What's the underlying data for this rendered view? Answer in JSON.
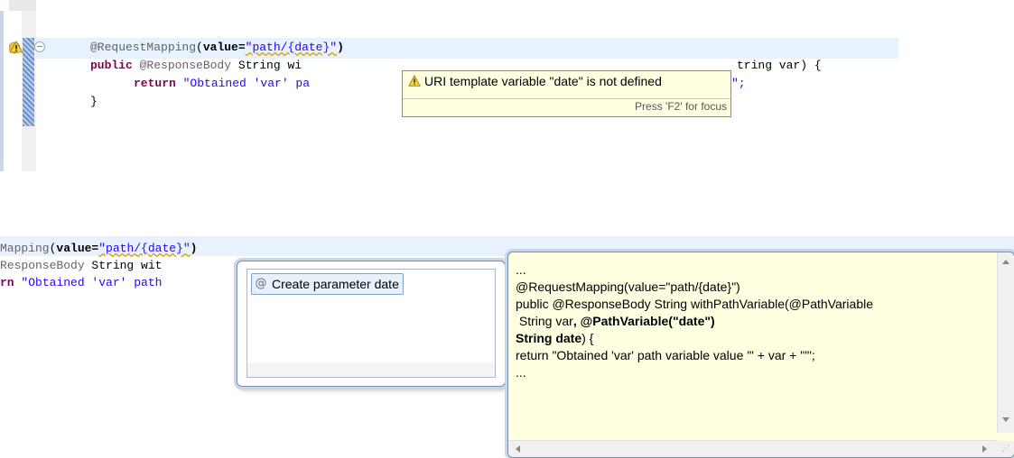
{
  "top_editor": {
    "lines": [
      {
        "ann": "@RequestMapping",
        "p1": "(",
        "p2": "value=",
        "str": "\"path/{date}\"",
        "p3": ")"
      },
      {
        "kw1": "public",
        "ann": " @ResponseBody",
        "p1": " String wi",
        "p2": "tring var) {"
      },
      {
        "kw1": "return",
        "str": " \"Obtained 'var' pa",
        "p2": "\";"
      },
      {
        "p1": "}"
      }
    ],
    "hover": {
      "message": "URI template variable \"date\" is not defined",
      "focus_hint": "Press 'F2' for focus",
      "icon": "warning-icon"
    }
  },
  "bottom_editor": {
    "lines": [
      {
        "ann": "Mapping",
        "p1": "(",
        "p2": "value=",
        "str": "\"path/{date}\"",
        "p3": ")"
      },
      {
        "ann": "ResponseBody",
        "p1": " String wit"
      },
      {
        "kw1": "rn",
        "str": " \"Obtained 'var' path"
      }
    ]
  },
  "quickfix": {
    "items": [
      {
        "label": "Create parameter date",
        "icon": "at-annotation-icon"
      }
    ]
  },
  "preview": {
    "lines": [
      {
        "normal": "..."
      },
      {
        "normal": "@RequestMapping(value=\"path/{date}\")"
      },
      {
        "normal": "public @ResponseBody String withPathVariable(@PathVariable"
      },
      {
        "normal": " String var",
        "bold": ", @PathVariable(\"date\")"
      },
      {
        "bold": "String date",
        "normal2": ") {"
      },
      {
        "normal": "return \"Obtained 'var' path variable value '\" + var + \"'\";"
      },
      {
        "normal": "..."
      }
    ]
  },
  "colors": {
    "keyword": "#7f0055",
    "annotation": "#646464",
    "string": "#2a00ff",
    "tooltip_bg": "#ffffe1",
    "current_line": "#e8f2fe"
  }
}
